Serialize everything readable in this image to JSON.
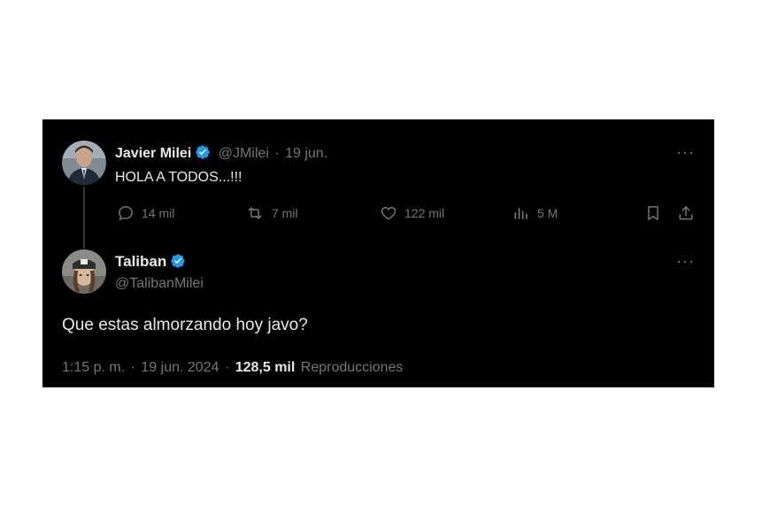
{
  "colors": {
    "background": "#000000",
    "text": "#e7e9ea",
    "muted": "#71767b",
    "verified": "#1d9bf0"
  },
  "reply_to": {
    "name": "Javier Milei",
    "handle": "@JMilei",
    "separator": "·",
    "date": "19 jun.",
    "text": "HOLA A TODOS...!!!",
    "avatar_icon": "profile-photo",
    "actions": {
      "replies": "14 mil",
      "reposts": "7 mil",
      "likes": "122 mil",
      "views": "5 M"
    }
  },
  "tweet": {
    "name": "Taliban",
    "handle": "@TalibanMilei",
    "avatar_icon": "profile-photo",
    "text": "Que estas almorzando hoy javo?",
    "time": "1:15 p. m.",
    "separator": "·",
    "date": "19 jun. 2024",
    "separator2": "·",
    "views_count": "128,5 mil",
    "views_label": "Reproducciones"
  },
  "more_label": "···"
}
